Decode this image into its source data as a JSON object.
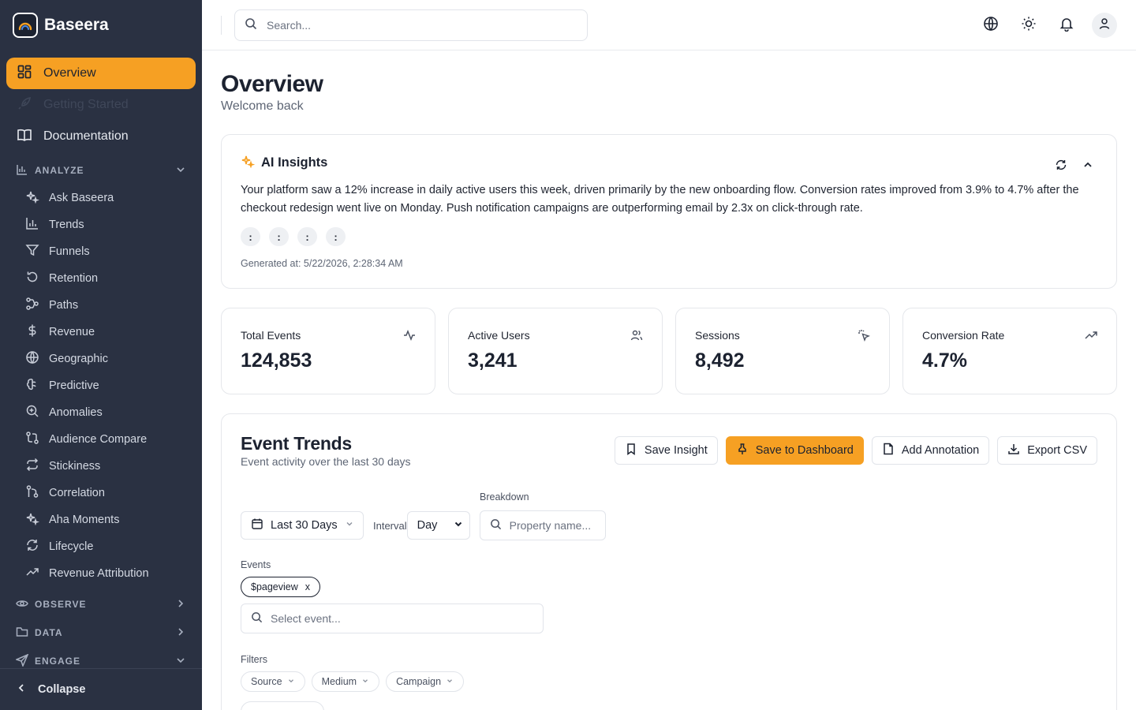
{
  "brand": {
    "name": "Baseera"
  },
  "sidebar": {
    "top_items": [
      {
        "label": "Overview",
        "icon": "layout-dashboard-icon",
        "active": true
      },
      {
        "label": "Getting Started",
        "icon": "rocket-icon",
        "faded": true
      },
      {
        "label": "Documentation",
        "icon": "book-open-icon"
      }
    ],
    "sections": {
      "analyze": {
        "label": "ANALYZE",
        "expanded": true,
        "items": [
          {
            "label": "Ask Baseera",
            "icon": "sparkles-icon"
          },
          {
            "label": "Trends",
            "icon": "bar-chart-icon"
          },
          {
            "label": "Funnels",
            "icon": "filter-icon"
          },
          {
            "label": "Retention",
            "icon": "rotate-ccw-icon"
          },
          {
            "label": "Paths",
            "icon": "workflow-icon"
          },
          {
            "label": "Revenue",
            "icon": "dollar-icon"
          },
          {
            "label": "Geographic",
            "icon": "globe-icon"
          },
          {
            "label": "Predictive",
            "icon": "brain-icon"
          },
          {
            "label": "Anomalies",
            "icon": "search-zoom-icon"
          },
          {
            "label": "Audience Compare",
            "icon": "git-compare-icon"
          },
          {
            "label": "Stickiness",
            "icon": "repeat-icon"
          },
          {
            "label": "Correlation",
            "icon": "git-branch-icon"
          },
          {
            "label": "Aha Moments",
            "icon": "sparkles-icon"
          },
          {
            "label": "Lifecycle",
            "icon": "refresh-icon"
          },
          {
            "label": "Revenue Attribution",
            "icon": "trending-up-icon"
          }
        ]
      },
      "observe": {
        "label": "OBSERVE"
      },
      "data": {
        "label": "DATA"
      },
      "engage": {
        "label": "ENGAGE"
      }
    },
    "collapse_label": "Collapse"
  },
  "topbar": {
    "search_placeholder": "Search...",
    "icons": [
      "globe-icon",
      "sun-icon",
      "bell-icon",
      "user-icon"
    ]
  },
  "page": {
    "title": "Overview",
    "subtitle": "Welcome back"
  },
  "insights": {
    "title": "AI Insights",
    "body": "Your platform saw a 12% increase in daily active users this week, driven primarily by the new onboarding flow. Conversion rates improved from 3.9% to 4.7% after the checkout redesign went live on Monday. Push notification campaigns are outperforming email by 2.3x on click-through rate.",
    "chips": [
      ":",
      ":",
      ":",
      ":"
    ],
    "generated": "Generated at: 5/22/2026, 2:28:34 AM"
  },
  "stats": [
    {
      "label": "Total Events",
      "value": "124,853",
      "icon": "activity-icon"
    },
    {
      "label": "Active Users",
      "value": "3,241",
      "icon": "users-icon"
    },
    {
      "label": "Sessions",
      "value": "8,492",
      "icon": "mouse-pointer-click-icon"
    },
    {
      "label": "Conversion Rate",
      "value": "4.7%",
      "icon": "trending-up-icon"
    }
  ],
  "trends": {
    "title": "Event Trends",
    "subtitle": "Event activity over the last 30 days",
    "actions": {
      "save_insight": "Save Insight",
      "save_dashboard": "Save to Dashboard",
      "add_annotation": "Add Annotation",
      "export_csv": "Export CSV"
    },
    "date_range": "Last 30 Days",
    "interval_label": "Interval",
    "interval_value": "Day",
    "breakdown_label": "Breakdown",
    "breakdown_placeholder": "Property name...",
    "events_label": "Events",
    "event_tag": "$pageview",
    "event_tag_remove": "x",
    "event_placeholder": "Select event...",
    "filters_label": "Filters",
    "filters": [
      "Source",
      "Medium",
      "Campaign"
    ]
  },
  "colors": {
    "accent": "#f6a023",
    "sidebar_bg": "#2a3142"
  }
}
